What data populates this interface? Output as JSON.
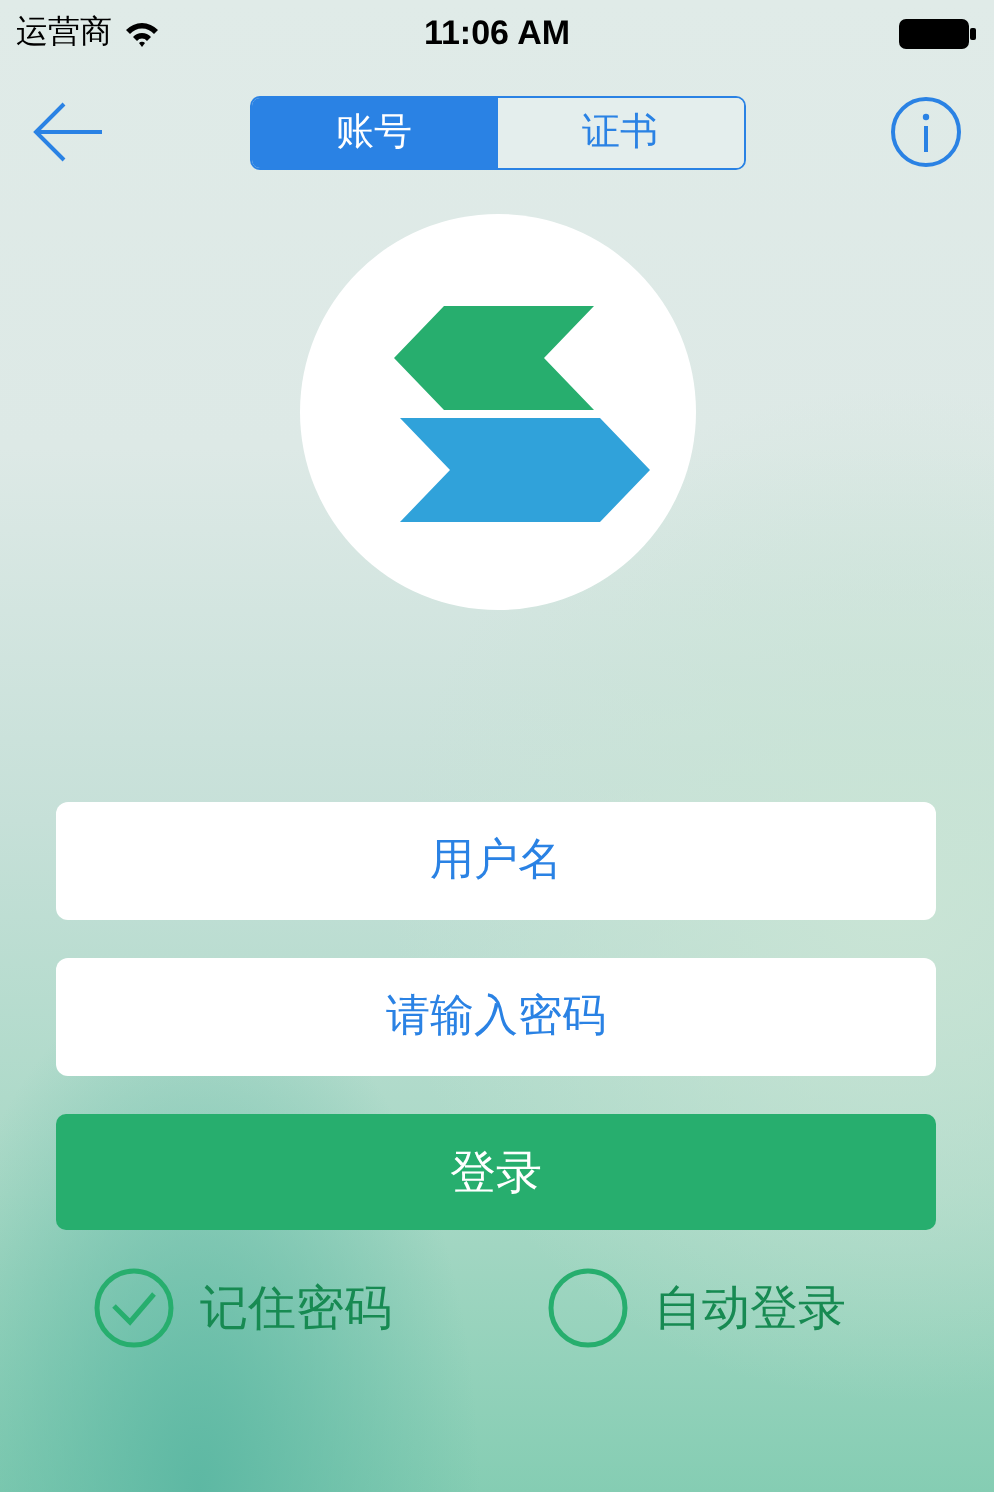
{
  "status_bar": {
    "carrier": "运营商",
    "time": "11:06 AM"
  },
  "tabs": [
    {
      "label": "账号",
      "selected": true
    },
    {
      "label": "证书",
      "selected": false
    }
  ],
  "username": {
    "placeholder": "用户名"
  },
  "password": {
    "placeholder": "请输入密码"
  },
  "login_button": "登录",
  "options": [
    {
      "label": "记住密码",
      "checked": true
    },
    {
      "label": "自动登录",
      "checked": false
    }
  ]
}
